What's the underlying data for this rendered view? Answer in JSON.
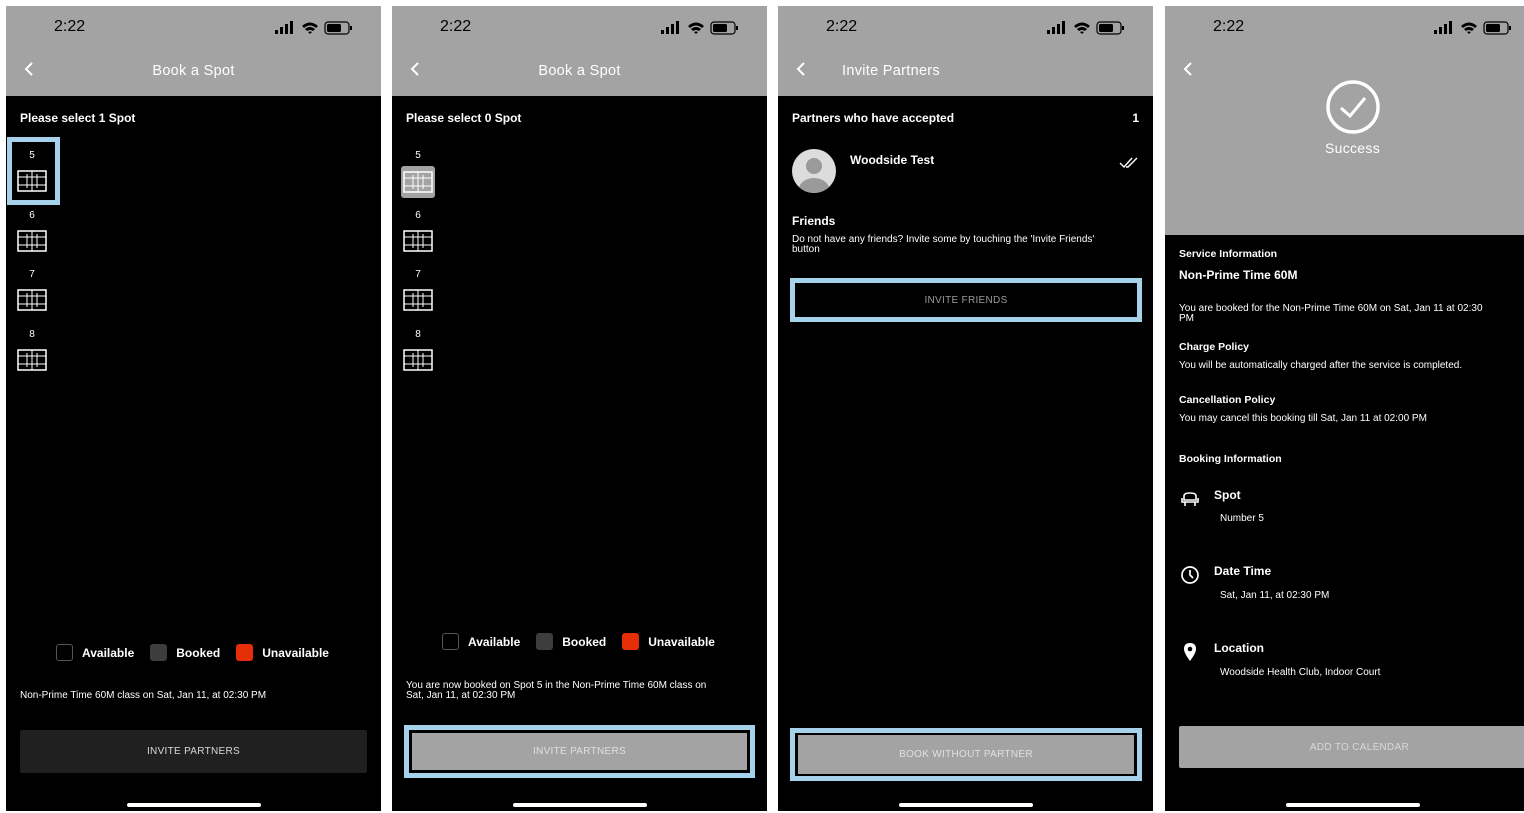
{
  "status_time": "2:22",
  "colors": {
    "header_bg": "#a3a3a3",
    "highlight": "#a5d2ea",
    "unavailable": "#e52d08",
    "booked": "#3d3d3d"
  },
  "screens": [
    {
      "title": "Book a Spot",
      "prompt": "Please select 1 Spot",
      "spots": [
        "5",
        "6",
        "7",
        "8"
      ],
      "legend": {
        "available": "Available",
        "booked": "Booked",
        "unavailable": "Unavailable"
      },
      "message": "Non-Prime Time 60M class on Sat, Jan 11, at 02:30 PM",
      "button": "INVITE PARTNERS"
    },
    {
      "title": "Book a Spot",
      "prompt": "Please select 0 Spot",
      "spots": [
        "5",
        "6",
        "7",
        "8"
      ],
      "legend": {
        "available": "Available",
        "booked": "Booked",
        "unavailable": "Unavailable"
      },
      "message_line1": "You are now booked on Spot 5 in the Non-Prime Time 60M class on",
      "message_line2": "Sat, Jan 11, at 02:30 PM",
      "button": "INVITE PARTNERS"
    },
    {
      "title": "Invite Partners",
      "accepted_label": "Partners who have accepted",
      "accepted_count": "1",
      "partner_name": "Woodside Test",
      "friends_label": "Friends",
      "friends_line1": "Do not have any friends? Invite some by touching the 'Invite Friends'",
      "friends_line2": "button",
      "invite_button": "INVITE FRIENDS",
      "book_button": "BOOK WITHOUT PARTNER"
    },
    {
      "success": "Success",
      "service_info_label": "Service Information",
      "service_name": "Non-Prime Time 60M",
      "booked_line1": "You are booked for the Non-Prime Time 60M on Sat, Jan 11 at 02:30",
      "booked_line2": "PM",
      "charge_label": "Charge Policy",
      "charge_text": "You will be automatically charged after the service is completed.",
      "cancel_label": "Cancellation Policy",
      "cancel_text": "You may cancel this booking till Sat, Jan 11 at 02:00 PM",
      "booking_info_label": "Booking Information",
      "spot_label": "Spot",
      "spot_value": "Number 5",
      "datetime_label": "Date Time",
      "datetime_value": "Sat, Jan 11, at 02:30 PM",
      "location_label": "Location",
      "location_value": "Woodside Health Club, Indoor Court",
      "button": "ADD TO CALENDAR"
    }
  ]
}
